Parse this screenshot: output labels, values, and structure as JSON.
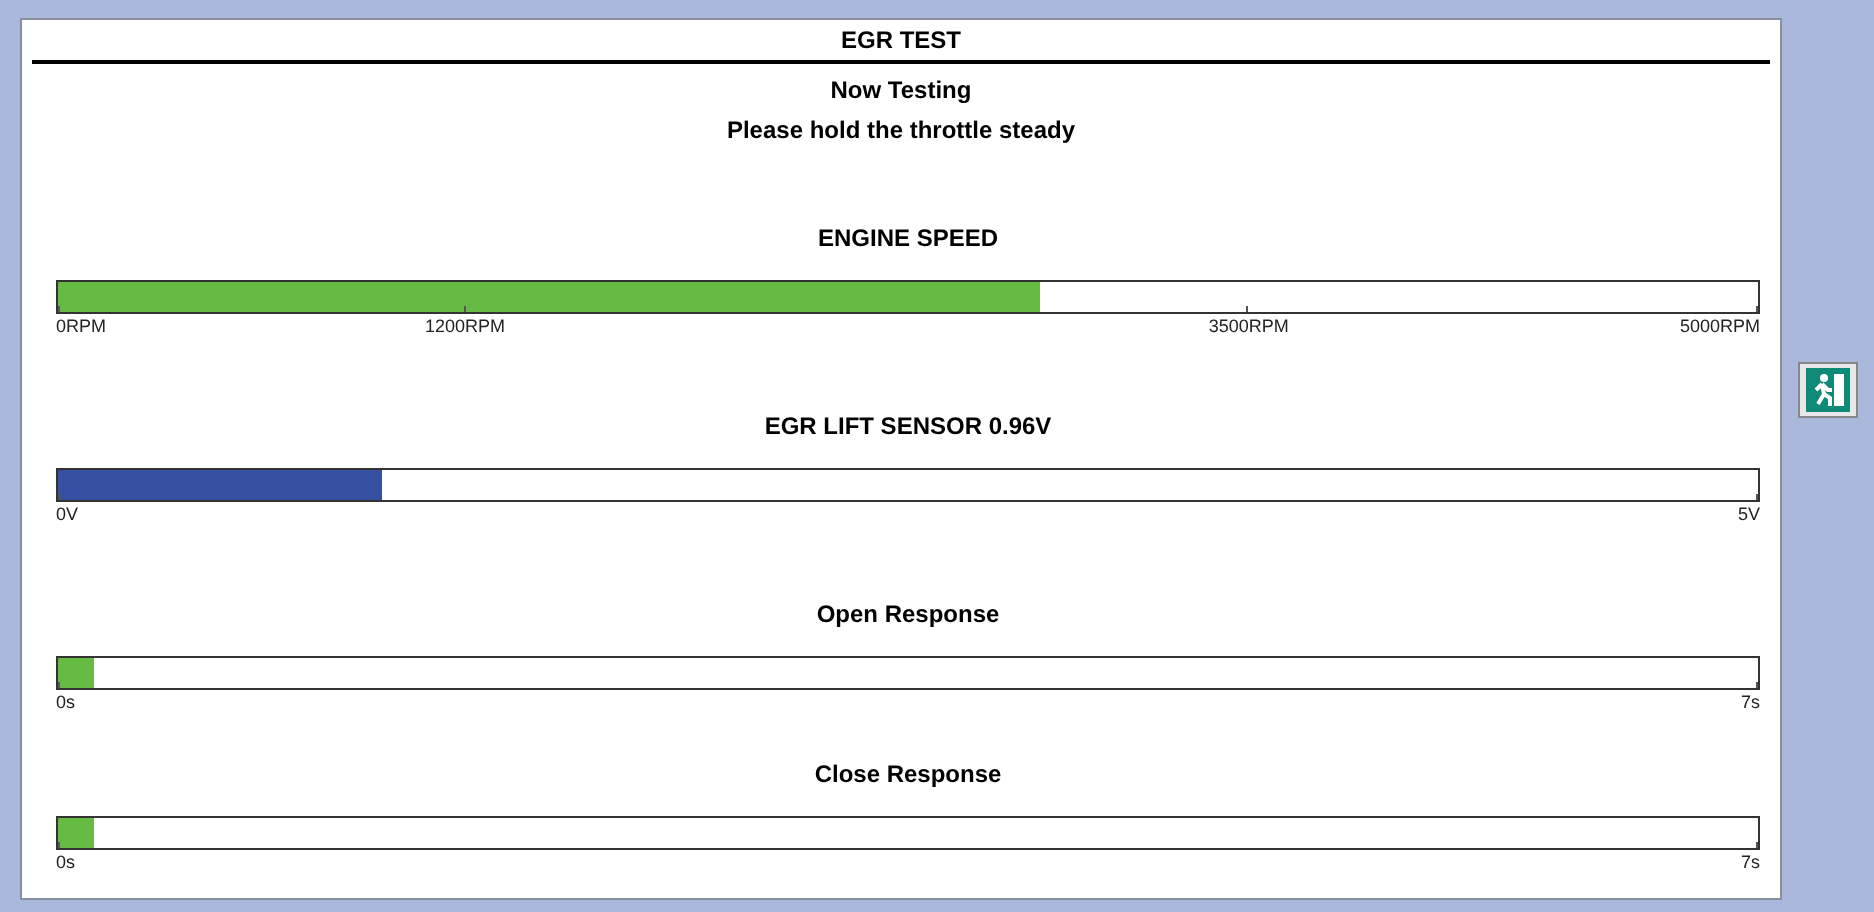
{
  "window": {
    "title": "EGR TEST"
  },
  "status": {
    "heading": "Now Testing",
    "instruction": "Please hold the throttle steady"
  },
  "gauges": [
    {
      "label": "ENGINE SPEED",
      "color": "#66bb44",
      "level": 0.578,
      "ticks": [
        {
          "label": "0RPM",
          "level": 0
        },
        {
          "label": "1200RPM",
          "level": 0.24
        },
        {
          "label": "3500RPM",
          "level": 0.7
        },
        {
          "label": "5000RPM",
          "level": 1
        }
      ]
    },
    {
      "label": "EGR LIFT SENSOR 0.96V",
      "color": "#3550a0",
      "level": 0.191,
      "ticks": [
        {
          "label": "0V",
          "level": 0
        },
        {
          "label": "5V",
          "level": 1
        }
      ]
    },
    {
      "label": "Open Response",
      "color": "#66bb44",
      "level": 0.021,
      "ticks": [
        {
          "label": "0s",
          "level": 0
        },
        {
          "label": "7s",
          "level": 1
        }
      ]
    },
    {
      "label": "Close Response",
      "color": "#66bb44",
      "level": 0.021,
      "ticks": [
        {
          "label": "0s",
          "level": 0
        },
        {
          "label": "7s",
          "level": 1
        }
      ]
    }
  ]
}
